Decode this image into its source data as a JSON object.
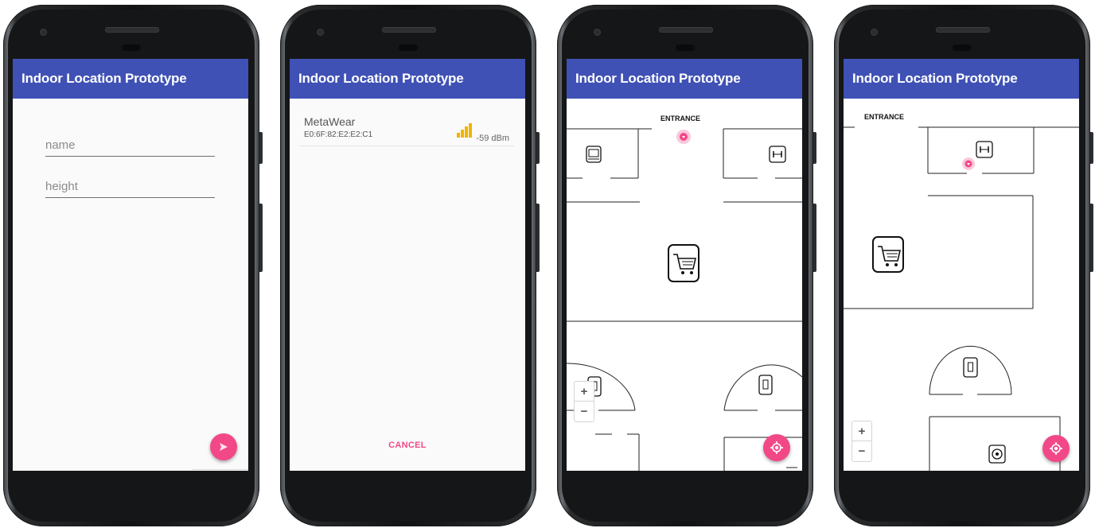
{
  "app": {
    "title": "Indoor Location Prototype"
  },
  "screen1": {
    "name_placeholder": "name",
    "height_placeholder": "height"
  },
  "screen2": {
    "device": {
      "name": "MetaWear",
      "mac": "E0:6F:82:E2:E2:C1",
      "rssi": "-59 dBm"
    },
    "cancel_label": "CANCEL"
  },
  "screen3": {
    "entrance_label": "ENTRANCE",
    "zoom_in": "+",
    "zoom_out": "−"
  },
  "screen4": {
    "entrance_label": "ENTRANCE",
    "zoom_in": "+",
    "zoom_out": "−"
  },
  "colors": {
    "appbar": "#3f51b5",
    "accent": "#f24887",
    "signal": "#f0b400"
  },
  "icons": [
    "send-icon",
    "signal-strength-icon",
    "my-location-icon",
    "shopping-cart-icon",
    "laptop-icon",
    "dumbbell-icon",
    "phone-icon",
    "football-icon",
    "location-marker-icon"
  ]
}
